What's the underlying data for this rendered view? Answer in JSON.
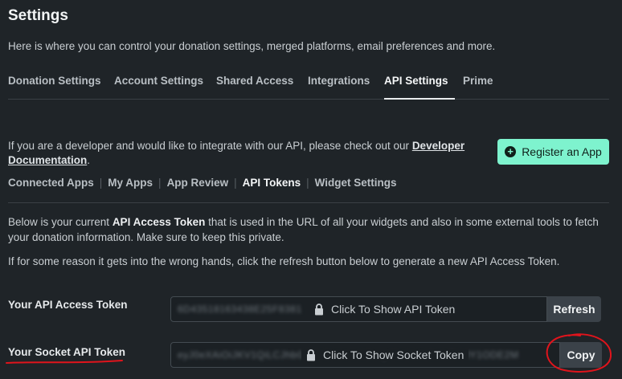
{
  "page": {
    "title": "Settings",
    "subtitle": "Here is where you can control your donation settings, merged platforms, email preferences and more."
  },
  "tabs": [
    {
      "label": "Donation Settings"
    },
    {
      "label": "Account Settings"
    },
    {
      "label": "Shared Access"
    },
    {
      "label": "Integrations"
    },
    {
      "label": "API Settings",
      "active": true
    },
    {
      "label": "Prime"
    }
  ],
  "developer": {
    "text": "If you are a developer and would like to integrate with our API, please check out our ",
    "link": "Developer Documentation",
    "after": ".",
    "register_label": "Register an App"
  },
  "subnav": [
    {
      "label": "Connected Apps"
    },
    {
      "label": "My Apps"
    },
    {
      "label": "App Review"
    },
    {
      "label": "API Tokens",
      "active": true
    },
    {
      "label": "Widget Settings"
    }
  ],
  "info": {
    "p1_pre": "Below is your current ",
    "p1_bold": "API Access Token",
    "p1_post": " that is used in the URL of all your widgets and also in some external tools to fetch your donation information. Make sure to keep this private.",
    "p2": "If for some reason it gets into the wrong hands, click the refresh button below to generate a new API Access Token."
  },
  "api_token": {
    "label": "Your API Access Token",
    "masked": "6D43518163438E25F8381",
    "show_text": "Click To Show API Token",
    "button": "Refresh"
  },
  "socket_token": {
    "label": "Your Socket API Token",
    "masked": "eyJ0eXAiOiJKV1QiLCJhbGciOiJIUzI1NiJ9.eyJ0b2tlbiI6IkNEM0Y1ODE2M",
    "show_text": "Click To Show Socket Token",
    "button": "Copy"
  },
  "colors": {
    "background": "#1f2428",
    "accent": "#7ef3ce",
    "annotation": "#e0141c"
  }
}
